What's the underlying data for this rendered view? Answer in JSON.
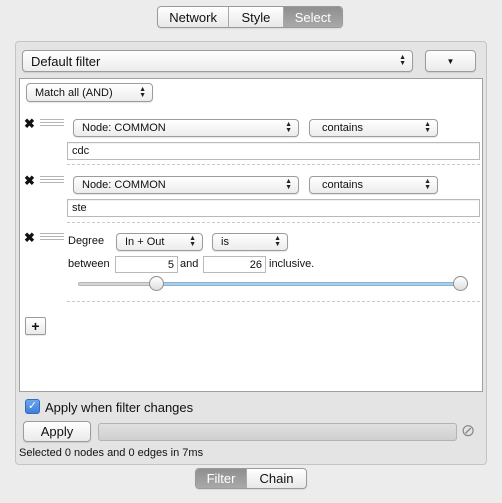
{
  "top_tabs": [
    "Network",
    "Style",
    "Select"
  ],
  "filter_select": {
    "value": "Default filter"
  },
  "options_arrow": "▼",
  "match_select": {
    "value": "Match all (AND)"
  },
  "conditions": [
    {
      "remove_icon": "✖",
      "column": "Node: COMMON",
      "operator": "contains",
      "value": "cdc"
    },
    {
      "remove_icon": "✖",
      "column": "Node: COMMON",
      "operator": "contains",
      "value": "ste"
    }
  ],
  "degree": {
    "remove_icon": "✖",
    "label": "Degree",
    "type_value": "In + Out",
    "operator": "is",
    "between_label": "between",
    "min": "5",
    "and_label": "and",
    "max": "26",
    "inclusive_label": "inclusive.",
    "slider_min_fraction": 0.19,
    "slider_max_fraction": 1.0
  },
  "add_button": "+",
  "apply_when_changes": {
    "label": "Apply when filter changes",
    "checked": true
  },
  "apply_button": "Apply",
  "cancel_icon": "⊘",
  "status": "Selected 0 nodes and 0 edges in 7ms",
  "bottom_tabs": [
    "Filter",
    "Chain"
  ],
  "colors": {
    "selected_tab": "#9a9a9a",
    "slider_fill": "#a9cfe9",
    "checkbox": "#3d7ed8"
  }
}
